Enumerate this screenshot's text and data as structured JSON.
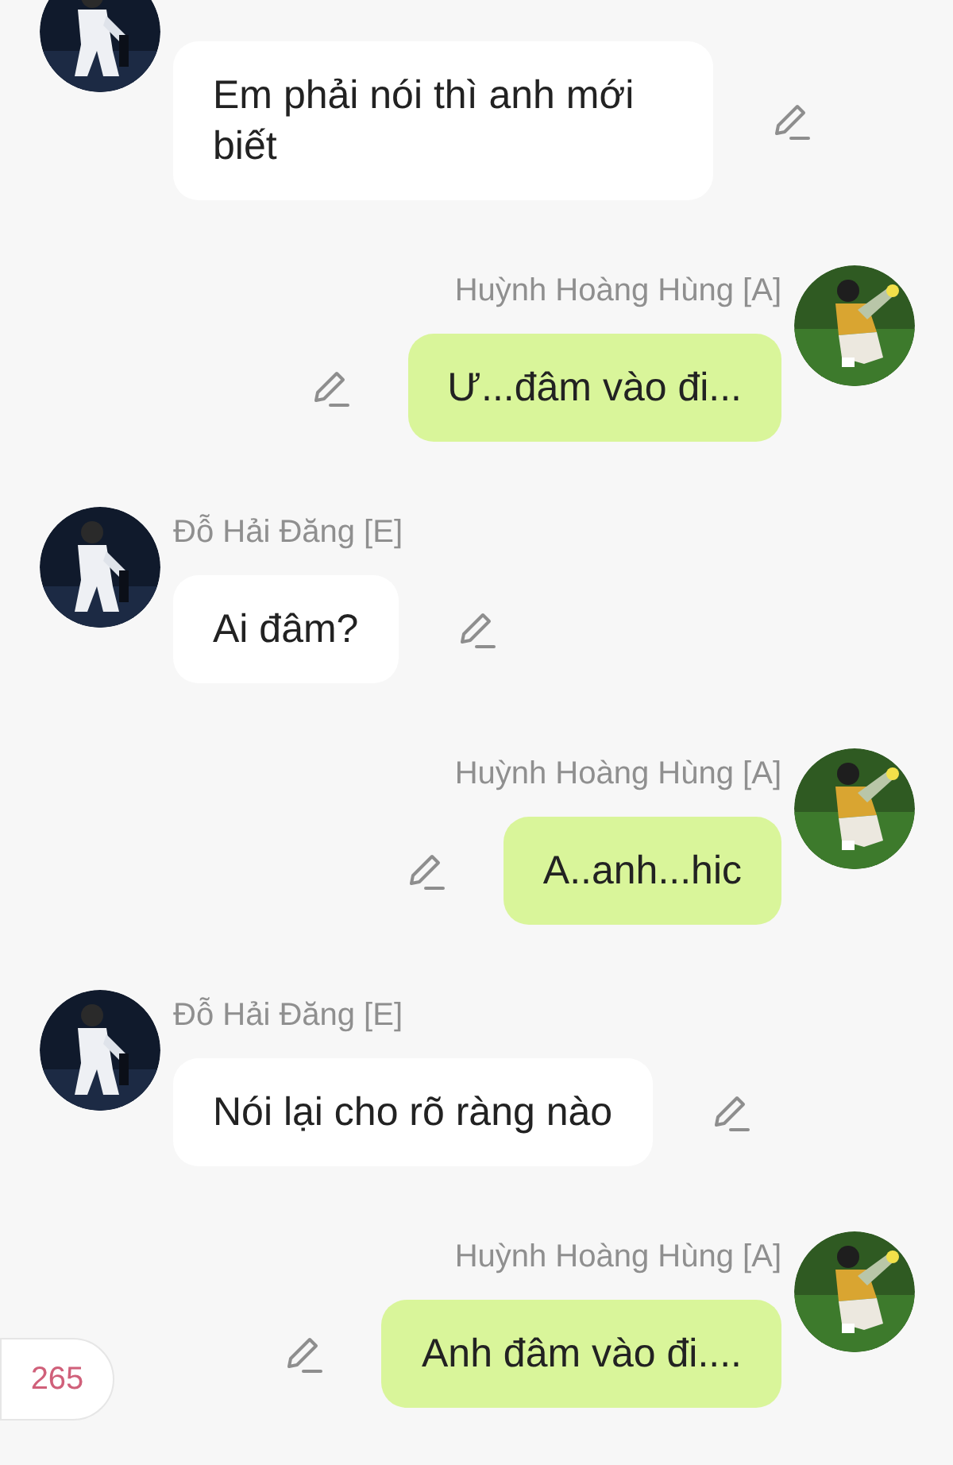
{
  "messages": [
    {
      "kind": "received",
      "text": "Em phải nói thì anh mới biết"
    },
    {
      "kind": "sent",
      "name": "Huỳnh Hoàng Hùng [A]",
      "text": "Ư...đâm vào đi..."
    },
    {
      "kind": "received",
      "name": "Đỗ Hải Đăng [E]",
      "text": "Ai đâm?"
    },
    {
      "kind": "sent",
      "name": "Huỳnh Hoàng Hùng [A]",
      "text": "A..anh...hic"
    },
    {
      "kind": "received",
      "name": "Đỗ Hải Đăng [E]",
      "text": "Nói lại cho rõ ràng nào"
    },
    {
      "kind": "sent",
      "name": "Huỳnh Hoàng Hùng [A]",
      "text": "Anh đâm vào đi...."
    }
  ],
  "counter": {
    "count": "265"
  }
}
